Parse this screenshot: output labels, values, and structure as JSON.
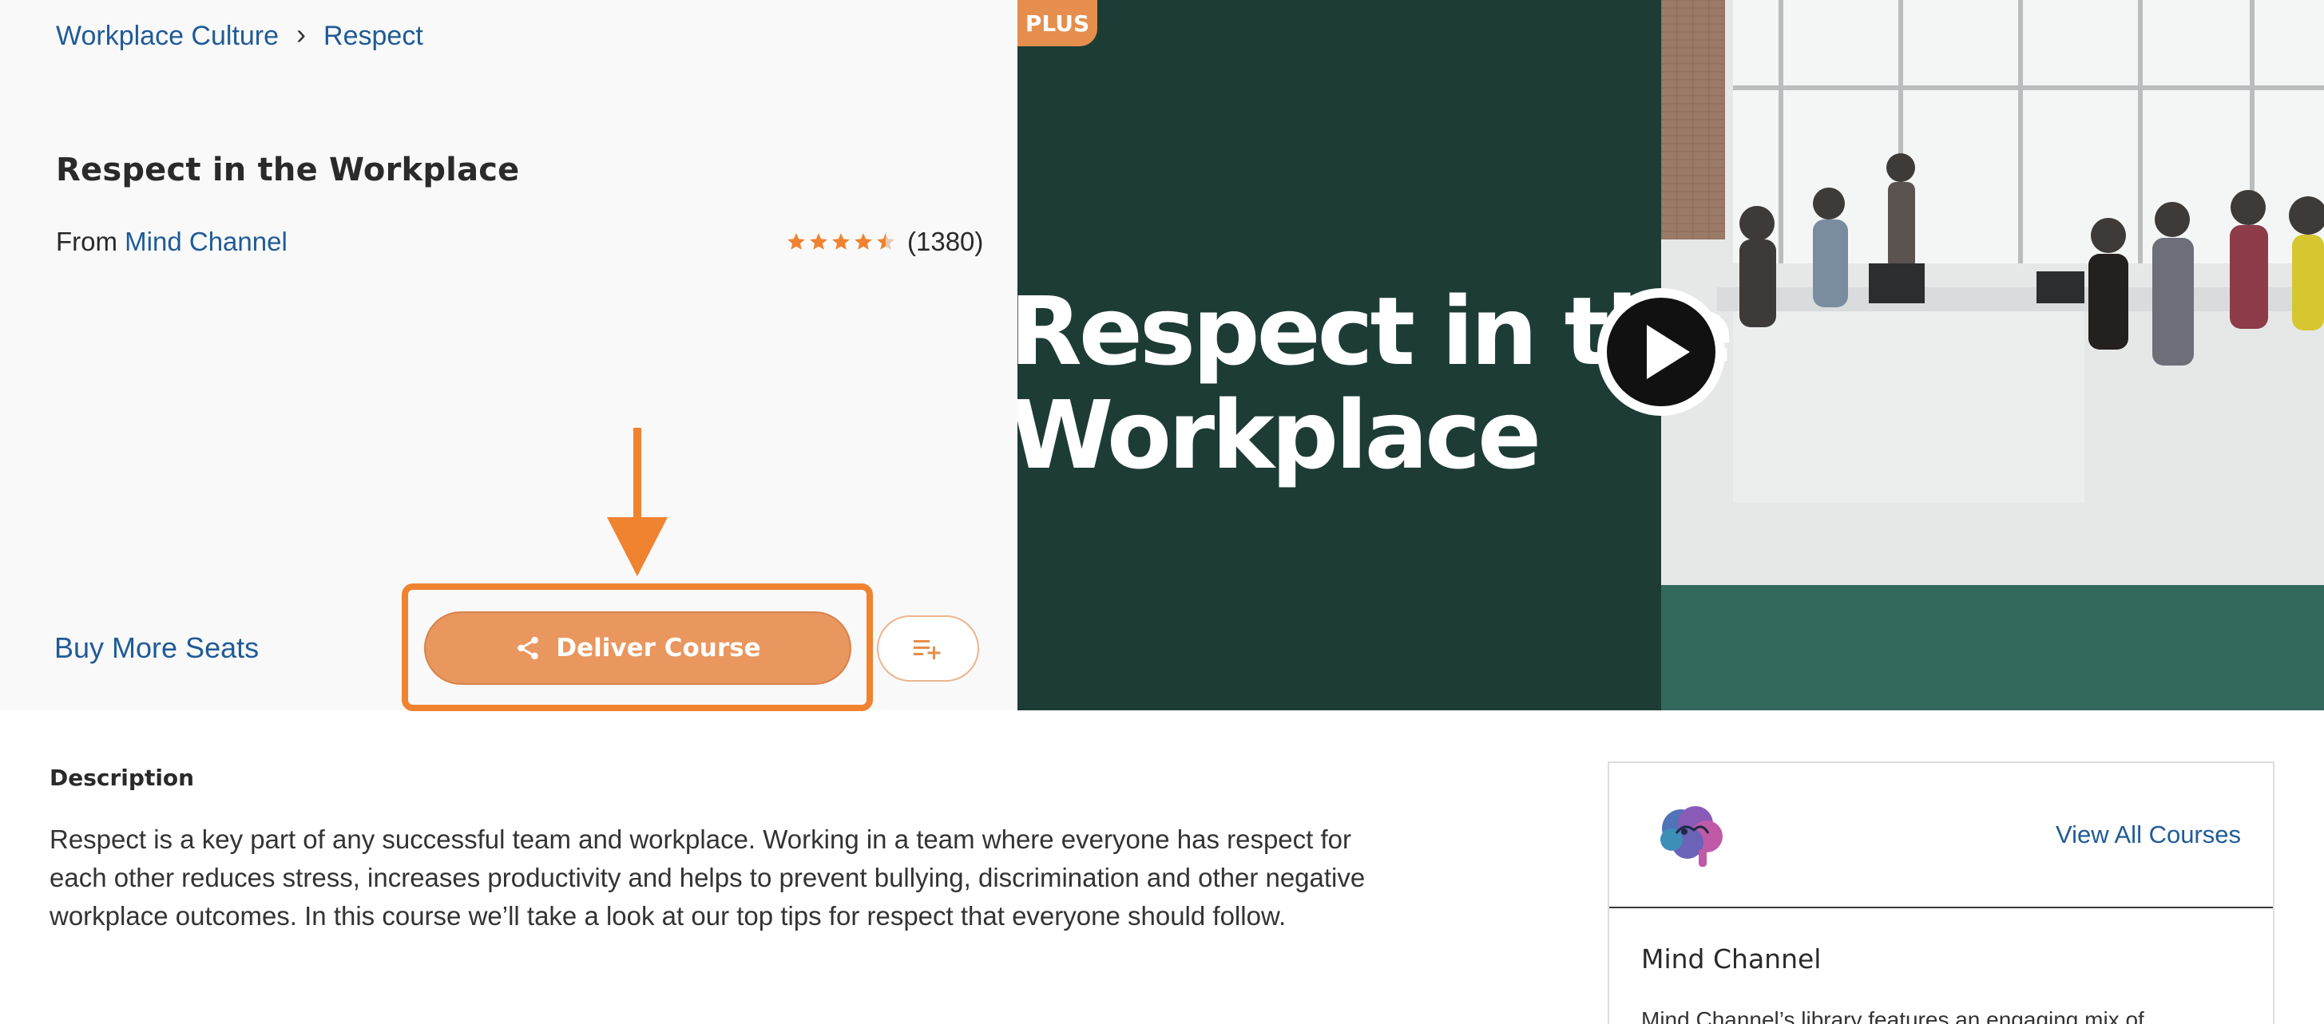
{
  "breadcrumb": {
    "items": [
      "Workplace Culture",
      "Respect"
    ],
    "separator": "›"
  },
  "course": {
    "title": "Respect in the Workplace",
    "from_label": "From",
    "provider": "Mind Channel",
    "rating_stars": 4.5,
    "rating_count": "(1380)"
  },
  "actions": {
    "buy_more_seats": "Buy More Seats",
    "deliver_course": "Deliver Course",
    "add_to_playlist_icon": "playlist-add-icon"
  },
  "video": {
    "badge": "PLUS",
    "title_line1": "Respect in the",
    "title_line2": "Workplace",
    "play_icon": "play-icon"
  },
  "description": {
    "heading": "Description",
    "body": "Respect is a key part of any successful team and workplace. Working in a team where everyone has respect for each other reduces stress, increases productivity and helps to prevent bullying, discrimination and other negative workplace outcomes. In this course we’ll take a look at our top tips for respect that everyone should follow."
  },
  "provider_card": {
    "view_all": "View All Courses",
    "name": "Mind Channel",
    "blurb": "Mind Channel’s library features an engaging mix of"
  },
  "colors": {
    "accent_orange": "#ef8330",
    "button_orange": "#e9975f",
    "link_blue": "#1f5b97",
    "video_dark_green": "#1d3c35",
    "video_band_green": "#33695c"
  }
}
